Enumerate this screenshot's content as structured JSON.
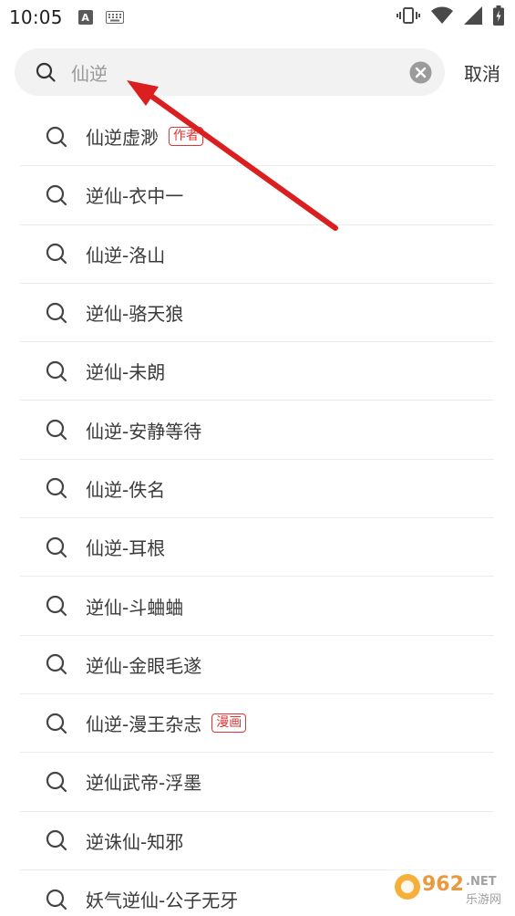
{
  "status_bar": {
    "time": "10:05",
    "badge": "A"
  },
  "search": {
    "query": "仙逆",
    "cancel_label": "取消"
  },
  "suggestions": [
    {
      "text": "仙逆虚渺",
      "tag": "作者"
    },
    {
      "text": "逆仙-衣中一",
      "tag": ""
    },
    {
      "text": "仙逆-洛山",
      "tag": ""
    },
    {
      "text": "逆仙-骆天狼",
      "tag": ""
    },
    {
      "text": "逆仙-未朗",
      "tag": ""
    },
    {
      "text": "仙逆-安静等待",
      "tag": ""
    },
    {
      "text": "仙逆-佚名",
      "tag": ""
    },
    {
      "text": "仙逆-耳根",
      "tag": ""
    },
    {
      "text": "逆仙-斗蛐蛐",
      "tag": ""
    },
    {
      "text": "逆仙-金眼毛遂",
      "tag": ""
    },
    {
      "text": "仙逆-漫王杂志",
      "tag": "漫画"
    },
    {
      "text": "逆仙武帝-浮墨",
      "tag": ""
    },
    {
      "text": "逆诛仙-知邪",
      "tag": ""
    },
    {
      "text": "妖气逆仙-公子无牙",
      "tag": ""
    }
  ],
  "watermark": {
    "brand": "962.NET",
    "site": "乐游网"
  },
  "colors": {
    "accent_red": "#e03535",
    "annotation_arrow": "#d91f1f",
    "search_bg": "#f2f2f2"
  },
  "icons": [
    "search-icon",
    "clear-icon",
    "vibrate-icon",
    "wifi-icon",
    "signal-icon",
    "battery-icon",
    "keyboard-icon"
  ]
}
